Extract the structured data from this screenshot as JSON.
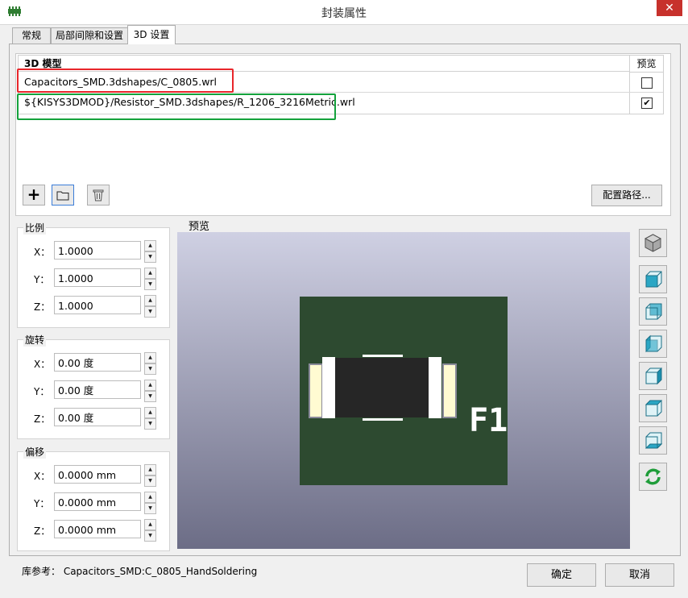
{
  "window": {
    "title": "封装属性",
    "close_icon": "close-icon"
  },
  "tabs": [
    {
      "label": "常规"
    },
    {
      "label": "局部间隙和设置"
    },
    {
      "label": "3D 设置"
    }
  ],
  "models": {
    "col_model": "3D 模型",
    "col_preview": "预览",
    "rows": [
      {
        "path": "Capacitors_SMD.3dshapes/C_0805.wrl",
        "preview": false
      },
      {
        "path": "${KISYS3DMOD}/Resistor_SMD.3dshapes/R_1206_3216Metric.wrl",
        "preview": true
      }
    ],
    "check_mark": "✔",
    "config_button": "配置路径..."
  },
  "scale": {
    "label": "比例",
    "x_label": "X：",
    "x": "1.0000",
    "y_label": "Y：",
    "y": "1.0000",
    "z_label": "Z：",
    "z": "1.0000"
  },
  "rotation": {
    "label": "旋转",
    "x_label": "X：",
    "x": "0.00 度",
    "y_label": "Y：",
    "y": "0.00 度",
    "z_label": "Z：",
    "z": "0.00 度"
  },
  "offset": {
    "label": "偏移",
    "x_label": "X：",
    "x": "0.0000 mm",
    "y_label": "Y：",
    "y": "0.0000 mm",
    "z_label": "Z：",
    "z": "0.0000 mm"
  },
  "preview": {
    "label": "预览",
    "ref_text": "F1",
    "board_color": "#2d4a30"
  },
  "footer": {
    "library_ref": "库参考： Capacitors_SMD:C_0805_HandSoldering",
    "ok_button": "确定",
    "cancel_button": "取消"
  },
  "colors": {
    "red_highlight": "#e8262b",
    "green_highlight": "#14a23c",
    "close_red": "#c7312c"
  }
}
